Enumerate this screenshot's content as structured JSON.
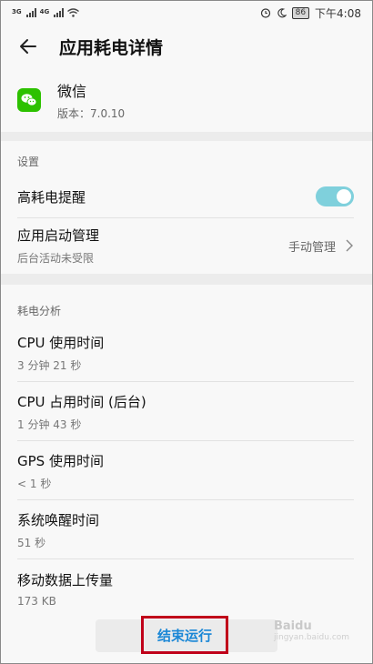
{
  "status_bar": {
    "sig1_tag": "3G",
    "sig2_tag": "4G",
    "battery": "86",
    "time": "下午4:08"
  },
  "header": {
    "title": "应用耗电详情"
  },
  "app": {
    "name": "微信",
    "version": "版本：7.0.10"
  },
  "settings": {
    "heading": "设置",
    "high_power_alert": {
      "title": "高耗电提醒",
      "enabled": true
    },
    "launch_mgmt": {
      "title": "应用启动管理",
      "sub": "后台活动未受限",
      "value": "手动管理"
    }
  },
  "analysis": {
    "heading": "耗电分析",
    "items": [
      {
        "title": "CPU 使用时间",
        "sub": "3 分钟 21 秒"
      },
      {
        "title": "CPU 占用时间 (后台)",
        "sub": "1 分钟 43 秒"
      },
      {
        "title": "GPS 使用时间",
        "sub": "< 1 秒"
      },
      {
        "title": "系统唤醒时间",
        "sub": "51 秒"
      },
      {
        "title": "移动数据上传量",
        "sub": "173 KB"
      }
    ]
  },
  "actions": {
    "end_label": "结束运行"
  },
  "watermark": {
    "text": "Baidu",
    "sub": "jingyan.baidu.com"
  },
  "colors": {
    "accent": "#1a87d6",
    "switch_on": "#7fd0dc",
    "highlight_box": "#c0001a",
    "wechat_green": "#2dc100"
  }
}
